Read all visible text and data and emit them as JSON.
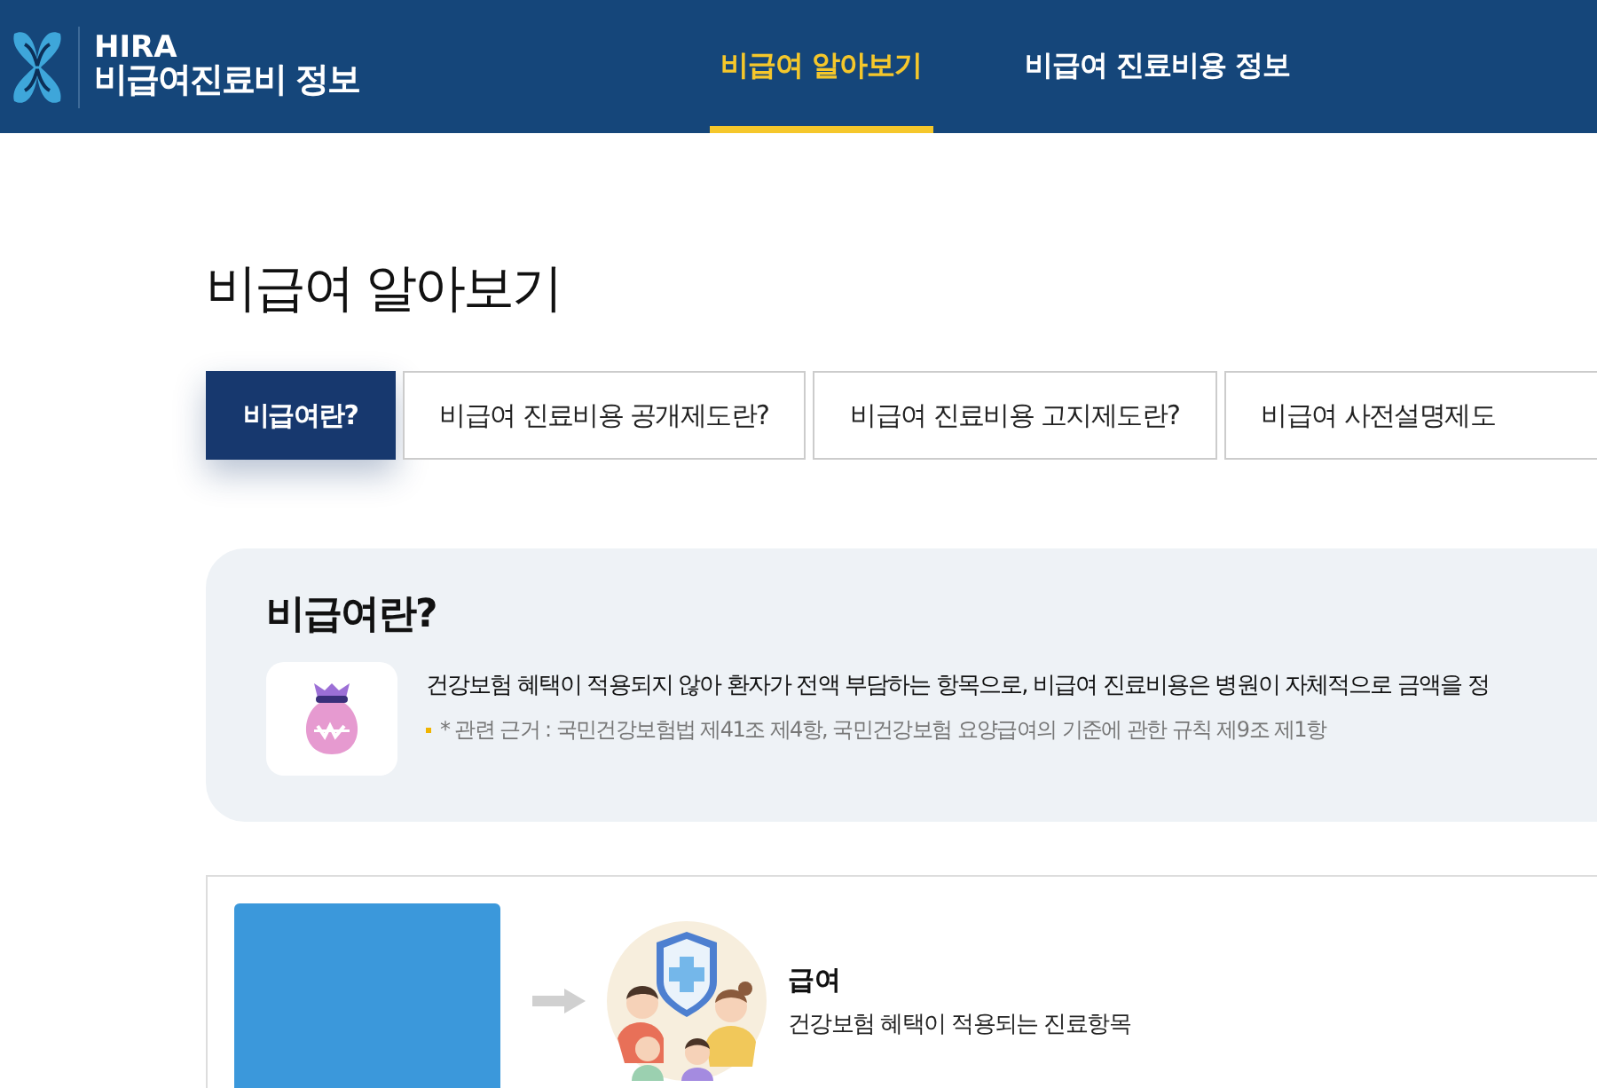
{
  "header": {
    "brand": "HIRA",
    "site_name": "비급여진료비 정보",
    "nav": [
      {
        "label": "비급여 알아보기",
        "selected": true
      },
      {
        "label": "비급여 진료비용 정보",
        "selected": false
      }
    ]
  },
  "page_title": "비급여 알아보기",
  "tabs": [
    {
      "label": "비급여란?",
      "selected": true
    },
    {
      "label": "비급여 진료비용 공개제도란?",
      "selected": false
    },
    {
      "label": "비급여 진료비용 고지제도란?",
      "selected": false
    },
    {
      "label": "비급여 사전설명제도",
      "selected": false
    }
  ],
  "info": {
    "title": "비급여란?",
    "description": "건강보험 혜택이 적용되지 않아 환자가 전액 부담하는 항목으로, 비급여 진료비용은 병원이 자체적으로 금액을 정",
    "note": "* 관련 근거 : 국민건강보험법 제41조 제4항, 국민건강보험 요양급여의 기준에 관한 규칙 제9조 제1항"
  },
  "coverage": {
    "title": "급여",
    "description": "건강보험 혜택이 적용되는 진료항목"
  }
}
